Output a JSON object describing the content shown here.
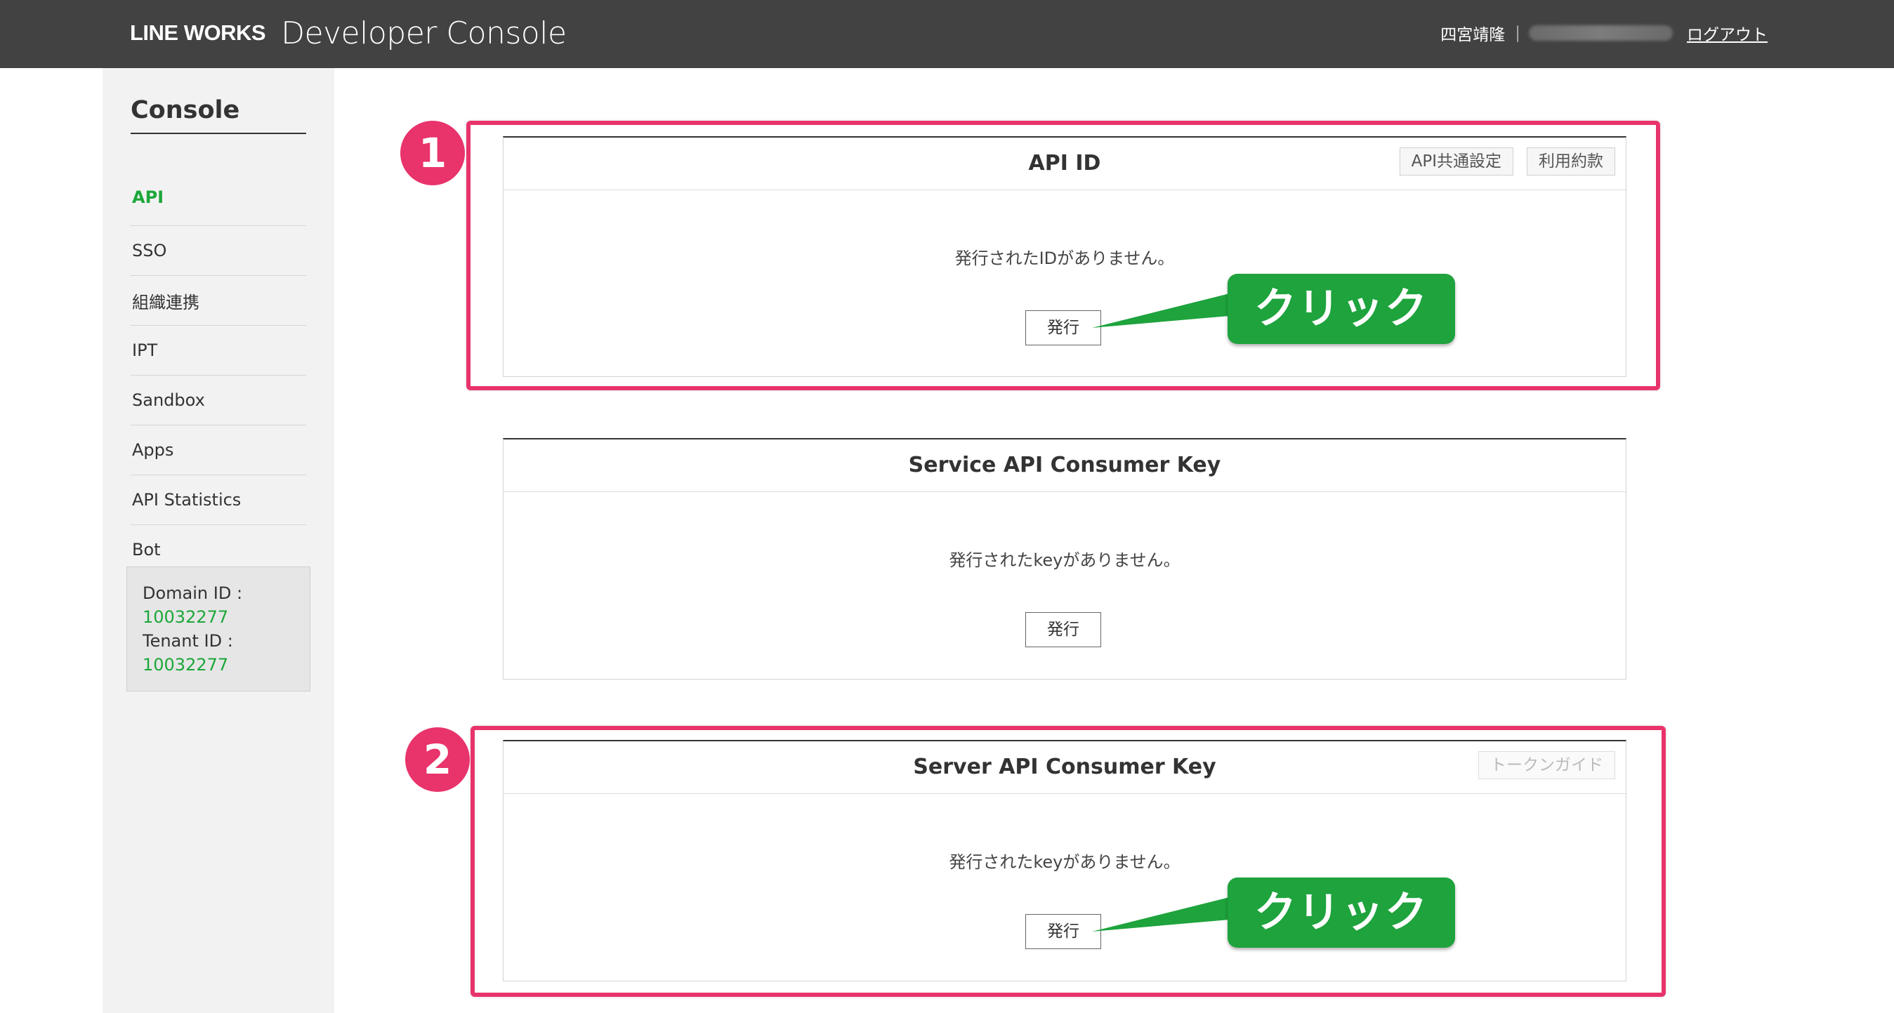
{
  "header": {
    "brand_logo": "LINE WORKS",
    "brand_title": "Developer Console",
    "user_name": "四宮靖隆",
    "user_separator": "|",
    "logout_label": "ログアウト"
  },
  "sidebar": {
    "title": "Console",
    "items": [
      {
        "label": "API",
        "active": true
      },
      {
        "label": "SSO"
      },
      {
        "label": "組織連携"
      },
      {
        "label": "IPT"
      },
      {
        "label": "Sandbox"
      },
      {
        "label": "Apps"
      },
      {
        "label": "API Statistics"
      },
      {
        "label": "Bot"
      }
    ],
    "domain_id_label": "Domain ID :",
    "domain_id_value": "10032277",
    "tenant_id_label": "Tenant ID :",
    "tenant_id_value": "10032277"
  },
  "panels": {
    "api_id": {
      "title": "API ID",
      "btn_common_settings": "API共通設定",
      "btn_terms": "利用約款",
      "message": "発行されたIDがありません。",
      "issue_label": "発行"
    },
    "service_key": {
      "title": "Service API Consumer Key",
      "message": "発行されたkeyがありません。",
      "issue_label": "発行"
    },
    "server_key": {
      "title": "Server API Consumer Key",
      "btn_token_guide": "トークンガイド",
      "message": "発行されたkeyがありません。",
      "issue_label": "発行"
    }
  },
  "annotations": {
    "step1": "1",
    "step2": "2",
    "callout1": "クリック",
    "callout2": "クリック",
    "highlight_color": "#e8336b",
    "callout_color": "#1ea33d"
  },
  "colors": {
    "header_bg": "#424242",
    "accent_green": "#1ca73a",
    "sidebar_bg": "#f2f2f2"
  }
}
